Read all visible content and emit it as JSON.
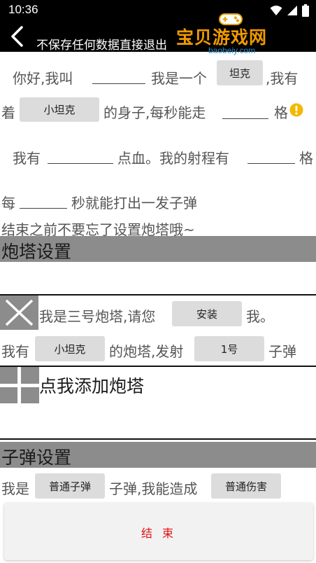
{
  "status_bar": {
    "time": "10:36"
  },
  "header": {
    "back_icon": "chevron-left-icon",
    "title": "不保存任何数据直接退出"
  },
  "tank_config": {
    "line1_prefix": "你好,我叫",
    "line1_mid": "我是一个",
    "type_button": "坦克",
    "line1_suffix": ",我有",
    "line2_prefix": "着",
    "body_button": "小坦克",
    "line2_mid": "的身子,每秒能走",
    "line2_suffix": "格",
    "warning_icon": "warning-icon",
    "line3_prefix": "我有",
    "line3_mid": "点血。我的射程有",
    "line3_suffix": "格",
    "line4_prefix": "每",
    "line4_suffix": "秒就能打出一发子弹",
    "line5": "结束之前不要忘了设置炮塔哦~"
  },
  "turret_section": {
    "title": "炮塔设置",
    "turret_item": {
      "remove_icon": "close-icon",
      "text_a": "我是三号炮塔,请您",
      "install_button": "安装",
      "text_b": "我。",
      "text_c": "我有",
      "body_button": "小坦克",
      "text_d": "的炮塔,发射",
      "slot_button": "1号",
      "text_e": "子弹"
    },
    "add_icon": "plus-icon",
    "add_label": "点我添加炮塔"
  },
  "bullet_section": {
    "title": "子弹设置",
    "text_a": "我是",
    "bullet_type_button": "普通子弹",
    "text_b": "子弹,我能造成",
    "damage_type_button": "普通伤害"
  },
  "footer": {
    "end_label": "结束",
    "watermark_text": "宝贝游戏网",
    "watermark_url": "baobeiy.com"
  },
  "colors": {
    "section_bg": "#8c8c8c",
    "button_bg": "#dcdcdc",
    "end_text": "#e01010",
    "warning": "#f5b800"
  }
}
